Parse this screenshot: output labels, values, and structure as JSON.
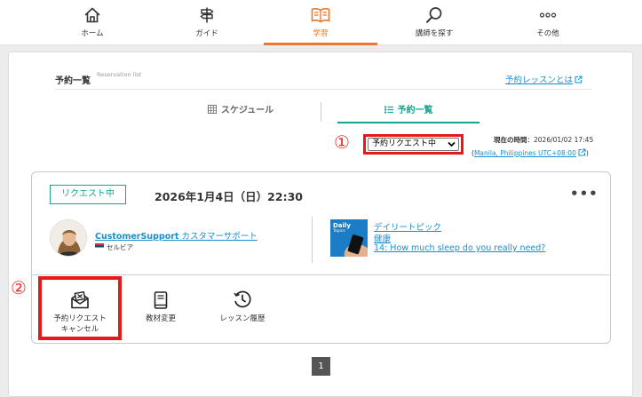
{
  "nav": {
    "items": [
      {
        "label": "ホーム",
        "icon": "home-icon"
      },
      {
        "label": "ガイド",
        "icon": "signpost-icon"
      },
      {
        "label": "学習",
        "icon": "book-icon"
      },
      {
        "label": "講師を探す",
        "icon": "search-icon"
      },
      {
        "label": "その他",
        "icon": "more-dots-icon"
      }
    ],
    "active_index": 2,
    "accent": "#e8792d"
  },
  "header": {
    "title": "予約一覧",
    "subtitle": "Reservation list",
    "about_link": "予約レッスンとは"
  },
  "tabs": {
    "schedule": "スケジュール",
    "list": "予約一覧",
    "active": "list",
    "active_color": "#1aa38e"
  },
  "filter": {
    "marker": "①",
    "selected": "予約リクエスト中"
  },
  "current_time": {
    "label": "現在の時間",
    "value": "：2026/01/02 17:45",
    "paren_open": "(",
    "timezone": "Manila, Philippines UTC+08:00",
    "paren_close": ")"
  },
  "reservation": {
    "status": "リクエスト中",
    "datetime": "2026年1月4日（日）22:30",
    "more": "•••",
    "tutor": {
      "name_en": "CustomerSupport",
      "name_ja": "カスタマーサポート",
      "country": "セルビア"
    },
    "material": {
      "thumb_title": "Daily",
      "thumb_sub": "Topics",
      "category": "デイリートピック",
      "subcategory": "健康",
      "title": "14: How much sleep do you really need?"
    },
    "actions": {
      "marker": "②",
      "cancel_line1": "予約リクエスト",
      "cancel_line2": "キャンセル",
      "change_material": "教材変更",
      "history": "レッスン履歴"
    }
  },
  "pagination": {
    "current": "1"
  }
}
